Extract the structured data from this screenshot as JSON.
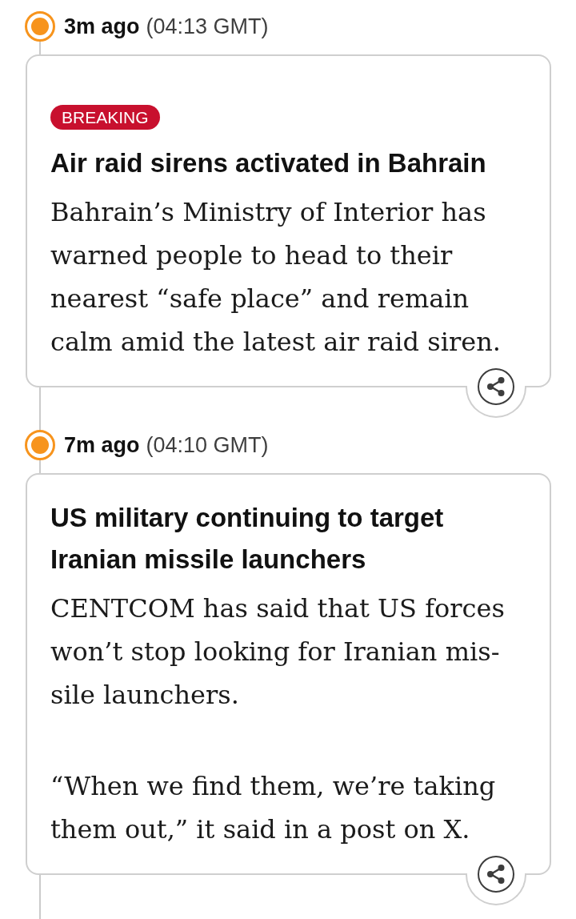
{
  "entries": [
    {
      "relative_time": "3m ago",
      "timestamp": "(04:13 GMT)",
      "badge": "BREAKING",
      "headline": "Air raid sirens activated in Bahrain",
      "paragraphs": [
        "Bahrain’s Ministry of Interior has warned people to head to their nearest “safe place” and remain calm amid the latest air raid siren."
      ]
    },
    {
      "relative_time": "7m ago",
      "timestamp": "(04:10 GMT)",
      "headline": "US military continuing to target Iranian missile launchers",
      "paragraphs": [
        "CENTCOM has said that US forces won’t stop looking for Iranian mis-sile launchers.",
        "“When we find them, we’re taking them out,” it said in a post on X."
      ]
    }
  ]
}
